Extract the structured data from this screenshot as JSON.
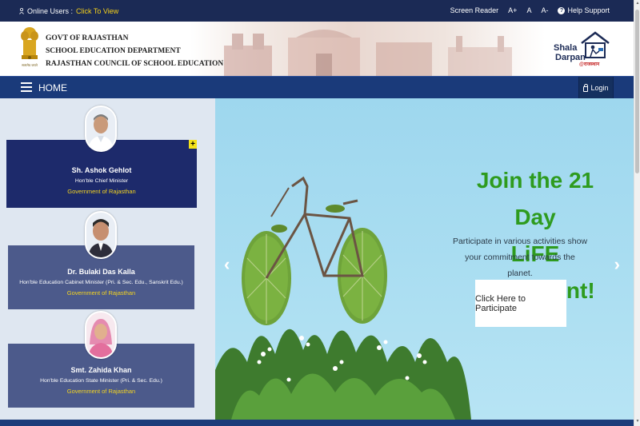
{
  "topbar": {
    "online_label": "Online Users :",
    "click_label": "Click To View",
    "screen_reader": "Screen Reader",
    "font_plus": "A+",
    "font_normal": "A",
    "font_minus": "A-",
    "help_support": "Help Support"
  },
  "header": {
    "line1": "GOVT OF RAJASTHAN",
    "line2": "SCHOOL EDUCATION DEPARTMENT",
    "line3": "RAJASTHAN COUNCIL OF SCHOOL EDUCATION",
    "logo_text_1": "Shala",
    "logo_text_2": "Darpan",
    "logo_text_3": "@राजस्थान"
  },
  "nav": {
    "home": "HOME",
    "login": "Login"
  },
  "profiles": [
    {
      "name": "Sh. Ashok Gehlot",
      "role": "Hon'ble Chief Minister",
      "gov": "Government of Rajasthan"
    },
    {
      "name": "Dr. Bulaki Das Kalla",
      "role": "Hon'ble Education Cabinet Minister (Pri. & Sec. Edu., Sanskrit Edu.)",
      "gov": "Government of Rajasthan"
    },
    {
      "name": "Smt. Zahida Khan",
      "role": "Hon'ble Education State Minister (Pri. & Sec. Edu.)",
      "gov": "Government of Rajasthan"
    }
  ],
  "slide": {
    "title_line1": "Join the 21 Day",
    "title_line2": "LiFE movement!",
    "text_line1": "Participate in various activities show",
    "text_line2": "your commitment towards the planet.",
    "cta": "Click Here to Participate"
  },
  "colors": {
    "topbar": "#1b2a55",
    "nav": "#1a3a7a",
    "card_primary": "#1d2a6b",
    "card_secondary": "#4c5a8b",
    "gold": "#f5d51f",
    "slide_green": "#2e9b1e",
    "slide_bg": "#a9ddf1"
  },
  "icons": [
    "user-icon",
    "help-icon",
    "menu-icon",
    "lock-icon",
    "plus-icon",
    "chevron-left-icon",
    "chevron-right-icon"
  ]
}
